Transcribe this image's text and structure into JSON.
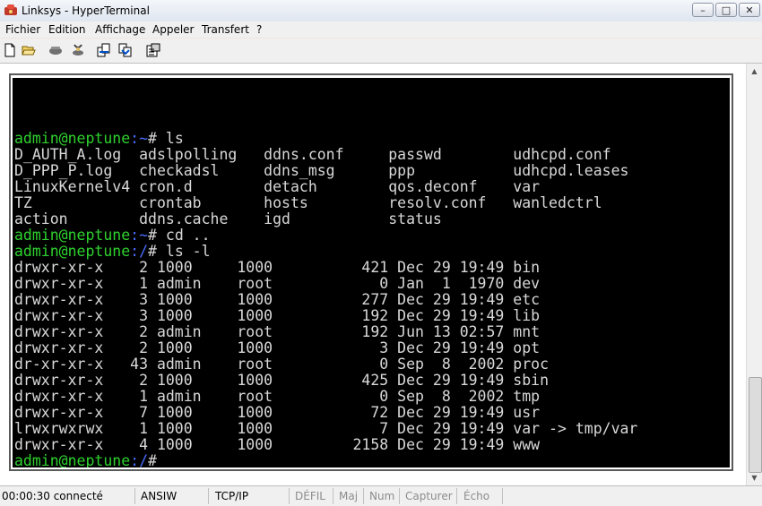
{
  "window": {
    "title": "Linksys - HyperTerminal"
  },
  "menu": [
    "Fichier",
    "Edition",
    "Affichage",
    "Appeler",
    "Transfert",
    "?"
  ],
  "toolbar_icons": [
    "new-document-icon",
    "open-folder-icon",
    "phone-connect-icon",
    "phone-disconnect-icon",
    "send-file-icon",
    "receive-file-icon",
    "properties-icon"
  ],
  "terminal": {
    "prompt_user": "admin@neptune",
    "lines": [
      {
        "user": "admin@neptune",
        "path": ":~",
        "text": "# ls"
      },
      {
        "text": "D_AUTH_A.log  adslpolling   ddns.conf     passwd        udhcpd.conf"
      },
      {
        "text": "D_PPP_P.log   checkadsl     ddns_msg      ppp           udhcpd.leases"
      },
      {
        "text": "LinuxKernelv4 cron.d        detach        qos.deconf    var"
      },
      {
        "text": "TZ            crontab       hosts         resolv.conf   wanledctrl"
      },
      {
        "text": "action        ddns.cache    igd           status"
      },
      {
        "user": "admin@neptune",
        "path": ":~",
        "text": "# cd .."
      },
      {
        "user": "admin@neptune",
        "path": ":/",
        "text": "# ls -l"
      },
      {
        "text": "drwxr-xr-x    2 1000     1000          421 Dec 29 19:49 bin"
      },
      {
        "text": "drwxr-xr-x    1 admin    root            0 Jan  1  1970 dev"
      },
      {
        "text": "drwxr-xr-x    3 1000     1000          277 Dec 29 19:49 etc"
      },
      {
        "text": "drwxr-xr-x    3 1000     1000          192 Dec 29 19:49 lib"
      },
      {
        "text": "drwxr-xr-x    2 admin    root          192 Jun 13 02:57 mnt"
      },
      {
        "text": "drwxr-xr-x    2 1000     1000            3 Dec 29 19:49 opt"
      },
      {
        "text": "dr-xr-xr-x   43 admin    root            0 Sep  8  2002 proc"
      },
      {
        "text": "drwxr-xr-x    2 1000     1000          425 Dec 29 19:49 sbin"
      },
      {
        "text": "drwxr-xr-x    1 admin    root            0 Sep  8  2002 tmp"
      },
      {
        "text": "drwxr-xr-x    7 1000     1000           72 Dec 29 19:49 usr"
      },
      {
        "text": "lrwxrwxrwx    1 1000     1000            7 Dec 29 19:49 var -> tmp/var"
      },
      {
        "text": "drwxr-xr-x    4 1000     1000         2158 Dec 29 19:49 www"
      },
      {
        "user": "admin@neptune",
        "path": ":/",
        "text": "#"
      }
    ]
  },
  "status": {
    "connected": "00:00:30 connecté",
    "emulation": "ANSIW",
    "protocol": "TCP/IP",
    "scroll": "DÉFIL",
    "caps": "Maj",
    "num": "Num",
    "capture": "Capturer",
    "echo": "Écho"
  },
  "colors": {
    "terminal_bg": "#000000",
    "terminal_fg": "#d8d8d8",
    "prompt_user": "#2ed12e",
    "prompt_path": "#4a6cff"
  }
}
